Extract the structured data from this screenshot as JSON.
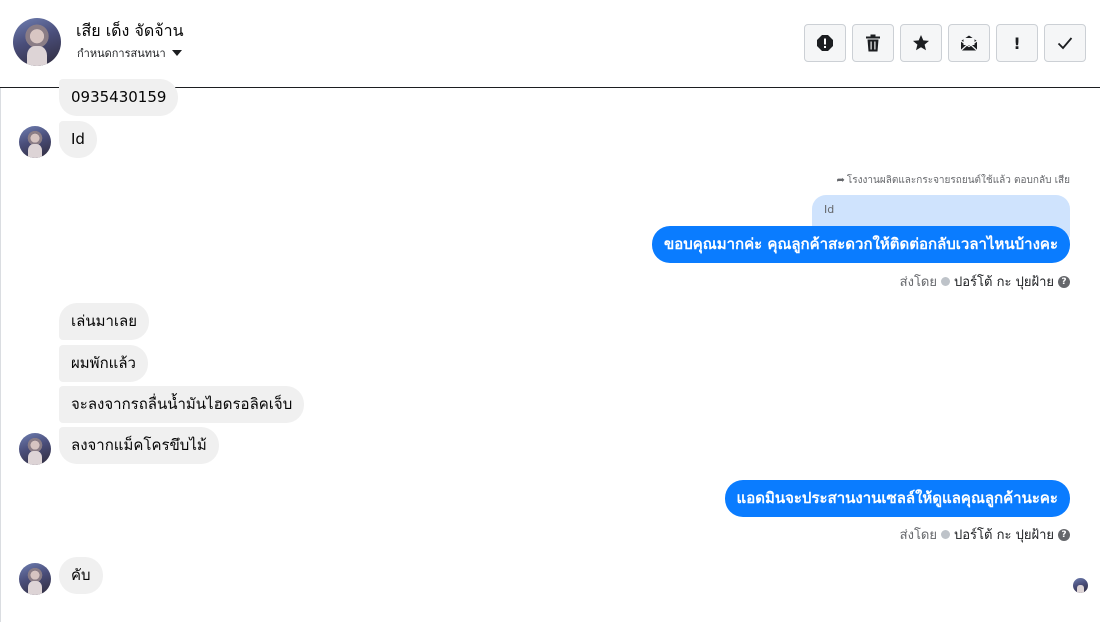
{
  "header": {
    "contact_name": "เสีย เด็ง จัดจ้าน",
    "assign_label": "กำหนดการสนทนา",
    "actions": [
      "spam-icon",
      "trash-icon",
      "star-icon",
      "mark-unread-icon",
      "follow-up-icon",
      "check-icon"
    ],
    "follow_up_glyph": "!"
  },
  "messages": {
    "in_phone": "0935430159",
    "in_id": "Id",
    "reply_meta": "โรงงานผลิตและกระจายรถยนต์ใช้แล้ว ตอบกลับ เสีย",
    "reply_quote": "Id",
    "out_1": "ขอบคุณมากค่ะ คุณลูกค้าสะดวกให้ติดต่อกลับเวลาไหนบ้างคะ",
    "sent_by_label": "ส่งโดย",
    "sent_by_name": "ปอร์โต้ กะ ปุยฝ้าย",
    "in_2a": "เล่นมาเลย",
    "in_2b": "ผมพักแล้ว",
    "in_2c": "จะลงจากรถลื่นน้ำมันไฮดรอลิคเจ็บ",
    "in_2d": "ลงจากแม็คโครขึบไม้",
    "out_2": "แอดมินจะประสานงานเซลล์ให้ดูแลคุณลูกค้านะคะ",
    "in_3": "คับ"
  },
  "colors": {
    "outgoing_bubble": "#0a7cff",
    "incoming_bubble": "#f0f0f0",
    "quote_bg": "#cfe3fd"
  }
}
